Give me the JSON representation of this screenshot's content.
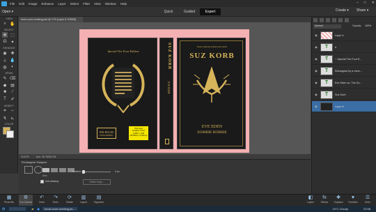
{
  "menu": {
    "items": [
      "File",
      "Edit",
      "Image",
      "Enhance",
      "Layer",
      "Select",
      "Filter",
      "View",
      "Window",
      "Help"
    ]
  },
  "modebar": {
    "open": "Open",
    "modes": [
      "Quick",
      "Guided",
      "Expert"
    ],
    "create": "Create",
    "share": "Share"
  },
  "doc": {
    "tab": "book-cover-working.psd @ 17% (Layer 8, RGB/8)",
    "zoom": "16.67%",
    "size": "Doc: 30.7M/63.7M"
  },
  "toolbox": {
    "sections": [
      "VIEW",
      "SELECT",
      "ENHANCE",
      "DRAW",
      "MODIFY",
      "COLOR"
    ]
  },
  "cover": {
    "back_title": "Special Tier Four Edition",
    "publisher_line1": "INK RULES",
    "publisher_line2": "PUBLISHING",
    "sticker": [
      "This cover",
      "contains: 6 Unit",
      "1,000 + x 100",
      "(35.25mm x 6 36mm)"
    ],
    "spine_title": "SUZ KORB",
    "spine_sub": "EVE EDEN",
    "front_top": "Book of Mercury Gallery Press Series",
    "front_title": "SUZ KORB",
    "front_sub1": "EVE EDEN",
    "front_sub2": "ZOMBIE ROBBIE"
  },
  "options": {
    "label": "Rectangular Marquee",
    "feather_label": "Feather:",
    "feather_value": "0 px",
    "antialias": "Anti-aliasing",
    "new": "New",
    "refine": "Refine Edge..."
  },
  "layers": {
    "mode": "Normal",
    "opacity_label": "Opacity:",
    "opacity_value": "100%",
    "items": [
      {
        "name": "Layer 4",
        "thumb": ""
      },
      {
        "name": "Ir",
        "thumb": "T"
      },
      {
        "name": "~ Special Tier Four E...",
        "thumb": "T"
      },
      {
        "name": "Kidnapped by a merc...",
        "thumb": "T"
      },
      {
        "name": "Eve Eden vs. The Zo...",
        "thumb": "T"
      },
      {
        "name": "Suz Korb",
        "thumb": "T"
      },
      {
        "name": "Layer 8",
        "thumb": ""
      }
    ]
  },
  "bottom_left": [
    "Photo Bin",
    "Tool Options",
    "Undo",
    "Redo",
    "Rotate",
    "Layout",
    "Organizer"
  ],
  "bottom_right": [
    "Layers",
    "Effects",
    "Graphics",
    "Favorites",
    "More"
  ],
  "taskbar": {
    "app": "book-cover-working.ps...",
    "weather": "10°C Cloudy",
    "time": "22:58"
  },
  "colors": {
    "accent": "#3a6ea5",
    "cover_bleed": "#f4b0b2",
    "gold": "#d7b45a"
  }
}
